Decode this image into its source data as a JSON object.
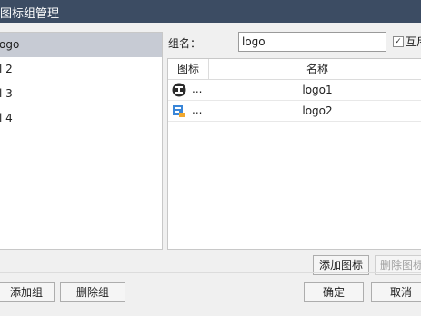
{
  "window": {
    "title": "图标组管理"
  },
  "groups": [
    {
      "label": "ogo",
      "selected": true
    },
    {
      "label": "l 2",
      "selected": false
    },
    {
      "label": "l 3",
      "selected": false
    },
    {
      "label": "l 4",
      "selected": false
    }
  ],
  "form": {
    "group_name_label": "组名：",
    "group_name_value": "logo",
    "exclusive_checkbox": {
      "checked": true,
      "mark": "✓",
      "label": "互斥"
    }
  },
  "icon_table": {
    "columns": [
      "图标",
      "名称"
    ],
    "rows": [
      {
        "icon": "logo1-circle-icon",
        "ellipsis": "...",
        "name": "logo1"
      },
      {
        "icon": "logo2-image-icon",
        "ellipsis": "...",
        "name": "logo2"
      }
    ]
  },
  "buttons": {
    "add_icon": "添加图标",
    "delete_icon": "删除图标",
    "add_group": "添加组",
    "delete_group": "删除组",
    "ok": "确定",
    "cancel": "取消"
  },
  "colors": {
    "title_bar": "#3c4c63",
    "selected_row": "#c7cbd4"
  }
}
